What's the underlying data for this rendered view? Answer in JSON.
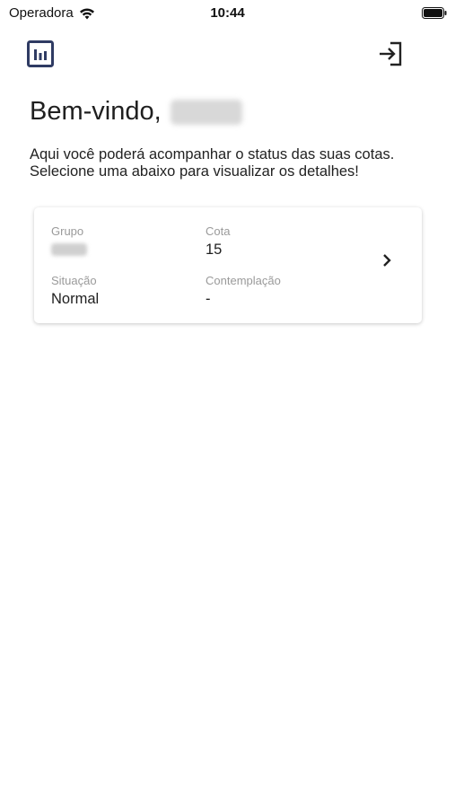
{
  "status_bar": {
    "carrier": "Operadora",
    "time": "10:44"
  },
  "header": {
    "chart_icon": "bar-chart-icon",
    "logout_icon": "logout-icon"
  },
  "welcome": {
    "greeting": "Bem-vindo,"
  },
  "intro": {
    "text": "Aqui você poderá acompanhar o status das suas cotas. Selecione uma abaixo para visualizar os detalhes!"
  },
  "quota_card": {
    "grupo_label": "Grupo",
    "cota_label": "Cota",
    "cota_value": "15",
    "situacao_label": "Situação",
    "situacao_value": "Normal",
    "contemplacao_label": "Contemplação",
    "contemplacao_value": "-",
    "chevron_icon": "chevron-right-icon"
  },
  "colors": {
    "accent": "#2f3b63",
    "text": "#1f1f1f",
    "muted": "#9a9a9a"
  }
}
